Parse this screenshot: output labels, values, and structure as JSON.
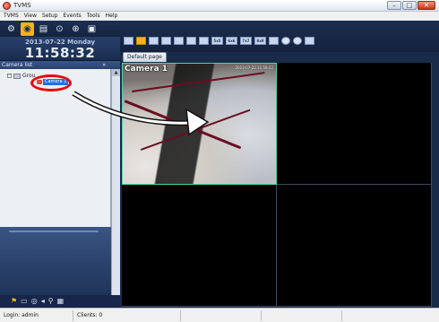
{
  "window": {
    "title": "TVMS",
    "controls": [
      "–",
      "□",
      "✕"
    ]
  },
  "menu": [
    "TVMS",
    "View",
    "Setup",
    "Events",
    "Tools",
    "Help"
  ],
  "toolbar": {
    "icons": [
      "gear-icon",
      "monitor-icon",
      "film-icon",
      "play-icon",
      "globe-icon",
      "document-icon"
    ],
    "active_index": 1
  },
  "clock": {
    "date": "2013-07-22 Monday",
    "time": "11:58:32"
  },
  "layouts": {
    "text_buttons": [
      "5x5",
      "6x6",
      "7x7",
      "8x8"
    ]
  },
  "camera_list": {
    "title": "Camera list",
    "collapse": "»",
    "root_label": "Grou",
    "camera_label": "Camera 1"
  },
  "page_tab": "Default page",
  "video": {
    "camera_name": "Camera 1",
    "timestamp": "2013-07-22 11:58:32"
  },
  "bottom_tools": [
    "tree-icon",
    "monitor-icon",
    "disc-icon",
    "speaker-icon",
    "zoom-icon",
    "grid-icon"
  ],
  "status": {
    "login": "Login: admin",
    "clients": "Clients: 0"
  },
  "colors": {
    "accent": "#f2b418",
    "panel": "#1a2b4a",
    "annotation": "#e10d0d"
  }
}
